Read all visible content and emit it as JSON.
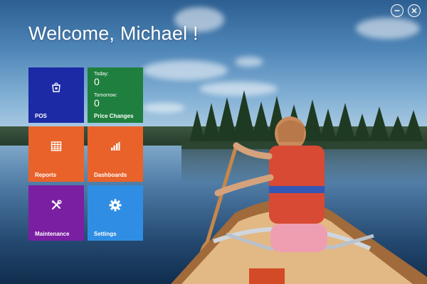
{
  "window": {
    "minimize_icon": "minimize-icon",
    "close_icon": "close-icon"
  },
  "welcome": {
    "title": "Welcome, Michael !"
  },
  "tiles": {
    "pos": {
      "label": "POS",
      "icon": "shopping-bag-icon",
      "color": "#1c2aa5"
    },
    "price_changes": {
      "label": "Price Changes",
      "today_label": "Today:",
      "today_value": "0",
      "tomorrow_label": "Tomorrow:",
      "tomorrow_value": "0",
      "color": "#1f7f3f"
    },
    "reports": {
      "label": "Reports",
      "icon": "table-icon",
      "color": "#e8622a"
    },
    "dashboards": {
      "label": "Dashboards",
      "icon": "bar-chart-icon",
      "color": "#e8622a"
    },
    "maintenance": {
      "label": "Maintenance",
      "icon": "tools-icon",
      "color": "#7a1fa2"
    },
    "settings": {
      "label": "Settings",
      "icon": "gear-icon",
      "color": "#2f8ee3"
    }
  }
}
